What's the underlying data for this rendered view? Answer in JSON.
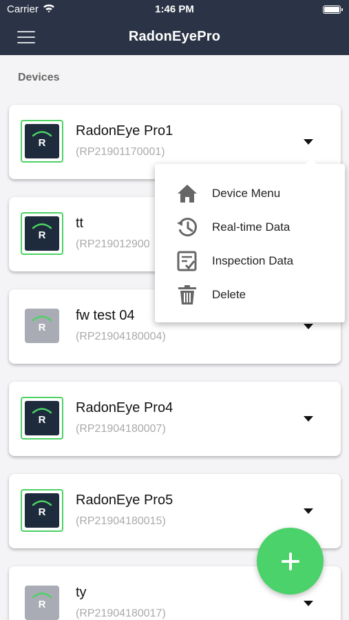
{
  "status_bar": {
    "carrier": "Carrier",
    "time": "1:46 PM"
  },
  "nav": {
    "title": "RadonEyePro",
    "menu_icon": "hamburger-menu-icon"
  },
  "section_label": "Devices",
  "device_icon_letter": "R",
  "colors": {
    "header_bg": "#2b3446",
    "online_border": "#4cd263",
    "fab_bg": "#4cd26a",
    "device_icon_bg": "#1e2b3d",
    "offline_icon_bg": "#a9acb4"
  },
  "devices": [
    {
      "name": "RadonEye Pro1",
      "serial": "(RP21901170001)",
      "status": "online"
    },
    {
      "name": "tt",
      "serial": "(RP219012900",
      "status": "online"
    },
    {
      "name": "fw test 04",
      "serial": "(RP21904180004)",
      "status": "offline"
    },
    {
      "name": "RadonEye Pro4",
      "serial": "(RP21904180007)",
      "status": "online"
    },
    {
      "name": "RadonEye Pro5",
      "serial": "(RP21904180015)",
      "status": "online"
    },
    {
      "name": "ty",
      "serial": "(RP21904180017)",
      "status": "offline"
    }
  ],
  "popup_menu": {
    "items": [
      {
        "label": "Device Menu",
        "icon": "home-icon"
      },
      {
        "label": "Real-time Data",
        "icon": "history-icon"
      },
      {
        "label": "Inspection Data",
        "icon": "checklist-icon"
      },
      {
        "label": "Delete",
        "icon": "trash-icon"
      }
    ]
  },
  "fab": {
    "icon": "plus-icon"
  }
}
